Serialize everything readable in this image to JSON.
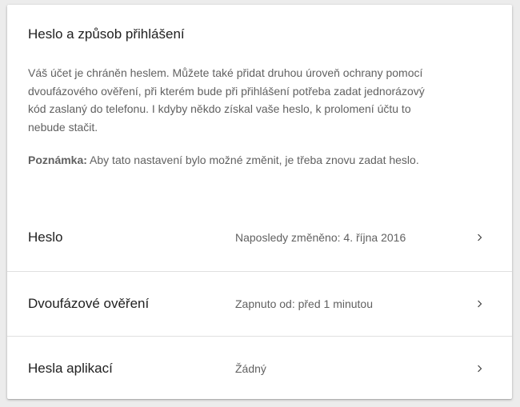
{
  "section": {
    "title": "Heslo a způsob přihlášení",
    "description": "Váš účet je chráněn heslem. Můžete také přidat druhou úroveň ochrany pomocí dvoufázového ověření, při kterém bude při přihlášení potřeba zadat jednorázový kód zaslaný do telefonu. I kdyby někdo získal vaše heslo, k prolomení účtu to nebude stačit.",
    "note_label": "Poznámka:",
    "note_text": " Aby tato nastavení bylo možné změnit, je třeba znovu zadat heslo."
  },
  "rows": [
    {
      "label": "Heslo",
      "value": "Naposledy změněno: 4. října 2016",
      "icon": "chevron-right-icon"
    },
    {
      "label": "Dvoufázové ověření",
      "value": "Zapnuto od: před 1 minutou",
      "icon": "chevron-right-icon"
    },
    {
      "label": "Hesla aplikací",
      "value": "Žádný",
      "icon": "chevron-right-icon"
    }
  ],
  "colors": {
    "background": "#ececec",
    "card": "#ffffff",
    "primary_text": "#212121",
    "secondary_text": "#616161",
    "divider": "#e0e0e0"
  }
}
